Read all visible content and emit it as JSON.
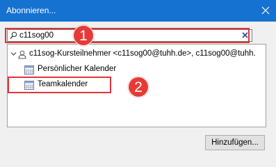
{
  "window": {
    "title": "Abonnieren...",
    "close_icon": "close-icon"
  },
  "search": {
    "value": "c11sog00",
    "icon": "search-icon",
    "clear_icon": "clear-icon"
  },
  "tree": {
    "parent": {
      "label": "c11sog-Kursteilnehmer <c11sog00@tuhh.de>, c11sog00@tuhh.",
      "icon": "user-icon",
      "expander_icon": "chevron-down-icon"
    },
    "children": [
      {
        "label": "Persönlicher Kalender",
        "icon": "calendar-icon"
      },
      {
        "label": "Teamkalender",
        "icon": "calendar-icon"
      }
    ]
  },
  "annotations": {
    "badge1": "1",
    "badge2": "2",
    "color": "#e13339"
  },
  "buttons": {
    "add_label": "Hinzufügen..."
  },
  "colors": {
    "titlebar": "#1572d1",
    "background": "#f0f0f0"
  }
}
